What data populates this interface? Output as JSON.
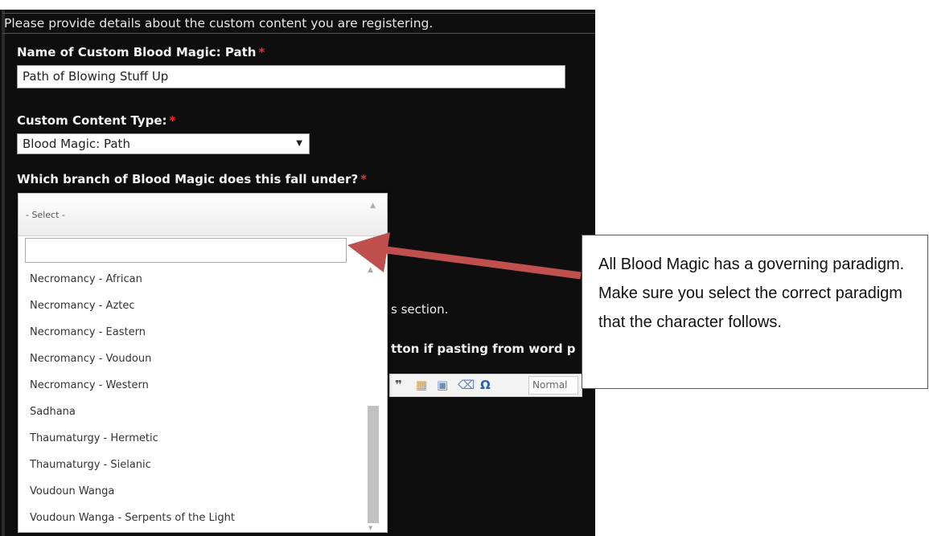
{
  "form": {
    "intro": "Please provide details about the custom content you are registering.",
    "name_label": "Name of Custom Blood Magic: Path",
    "name_value": "Path of Blowing Stuff Up",
    "type_label": "Custom Content Type:",
    "type_value": "Blood Magic: Path",
    "branch_label": "Which branch of Blood Magic does this fall under?",
    "required_marker": "*"
  },
  "dropdown": {
    "selected": "- Select -",
    "search_value": "",
    "options": [
      "Necromancy - African",
      "Necromancy - Aztec",
      "Necromancy - Eastern",
      "Necromancy - Voudoun",
      "Necromancy - Western",
      "Sadhana",
      "Thaumaturgy - Hermetic",
      "Thaumaturgy - Sielanic",
      "Voudoun Wanga",
      "Voudoun Wanga - Serpents of the Light"
    ]
  },
  "background_peek": {
    "section_text": "s section.",
    "paste_text": "tton if pasting from word p"
  },
  "editor_toolbar": {
    "format_value": "Normal"
  },
  "callout": {
    "text": "All Blood Magic has a governing paradigm.  Make sure you select the correct paradigm that the character follows."
  },
  "colors": {
    "background": "#0e0e0e",
    "required": "#e53030",
    "arrow": "#c0504d"
  }
}
